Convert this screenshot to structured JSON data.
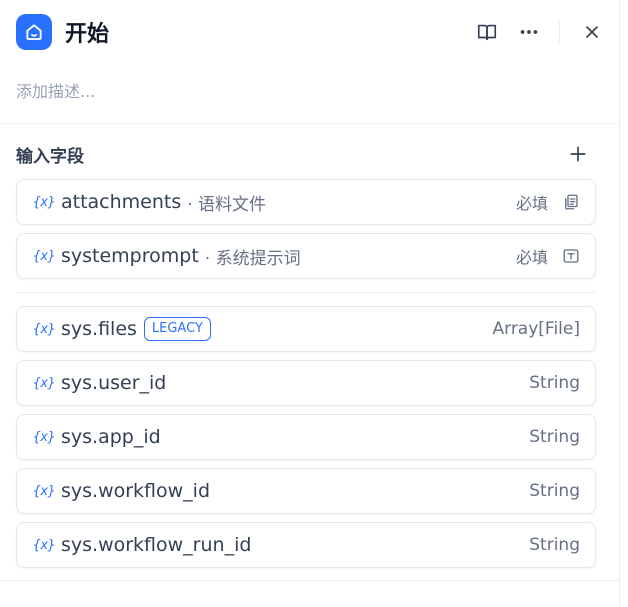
{
  "header": {
    "title": "开始",
    "accent_color": "#2970ff",
    "icons": [
      "home-icon",
      "book-open-icon",
      "more-icon",
      "close-icon"
    ]
  },
  "description_placeholder": "添加描述...",
  "section": {
    "title": "输入字段",
    "add_icon": "plus-icon"
  },
  "input_fields": [
    {
      "var_icon": "{x}",
      "name": "attachments",
      "label": "· 语料文件",
      "required": "必填",
      "type_icon": "file-list-icon"
    },
    {
      "var_icon": "{x}",
      "name": "systemprompt",
      "label": "· 系统提示词",
      "required": "必填",
      "type_icon": "text-input-icon"
    }
  ],
  "system_vars": [
    {
      "var_icon": "{x}",
      "name": "sys.files",
      "badge": "LEGACY",
      "type": "Array[File]"
    },
    {
      "var_icon": "{x}",
      "name": "sys.user_id",
      "type": "String"
    },
    {
      "var_icon": "{x}",
      "name": "sys.app_id",
      "type": "String"
    },
    {
      "var_icon": "{x}",
      "name": "sys.workflow_id",
      "type": "String"
    },
    {
      "var_icon": "{x}",
      "name": "sys.workflow_run_id",
      "type": "String"
    }
  ]
}
